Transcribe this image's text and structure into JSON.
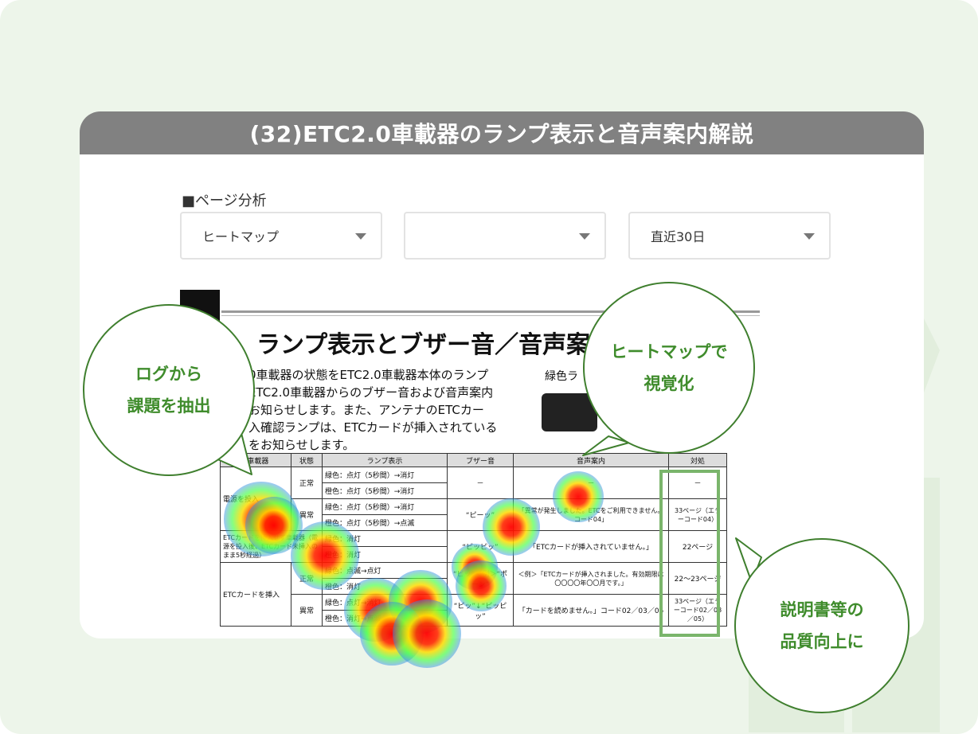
{
  "header": {
    "title": "(32)ETC2.0車載器のランプ表示と音声案内解説"
  },
  "section_label": "■ページ分析",
  "dropdowns": [
    {
      "value": "ヒートマップ"
    },
    {
      "value": ""
    },
    {
      "value": "直近30日"
    }
  ],
  "document": {
    "title": "ランプ表示とブザー音／音声案",
    "intro": "0車載器の状態をETC2.0車載器本体のランプ\nETC2.0車載器からのブザー音および音声案内\nお知らせします。また、アンテナのETCカー\n入確認ランプは、ETCカードが挿入されている\nをお知らせします。",
    "lamp_label": "緑色ラ",
    "table_headers": [
      "0車載器",
      "状態",
      "ランプ表示",
      "ブザー音",
      "音声案内",
      "対処"
    ],
    "rows": [
      {
        "c1": "電源を投入",
        "c2": "正常",
        "c3a": "緑色：点灯（5秒間）→消灯",
        "c3b": "橙色：点灯（5秒間）→消灯",
        "c4": "－",
        "c5": "－",
        "c6": "－"
      },
      {
        "c2": "異常",
        "c3a": "緑色：点灯（5秒間）→消灯",
        "c3b": "橙色：点灯（5秒間）→点滅",
        "c4": "“ピーッ”",
        "c5": "「異常が発生しました。ETCをご利用できません。コード04」",
        "c6": "33ページ（エラーコード04）"
      },
      {
        "c1": "ETCカードを挿入せず車載器（電源を投入後、ETCカード未挿入のまま5秒経過）",
        "c3a": "緑色：消灯",
        "c3b": "橙色：消灯",
        "c4": "“ピッピッ”",
        "c5": "「ETCカードが挿入されていません。」",
        "c6": "22ページ"
      },
      {
        "c1": "ETCカードを挿入",
        "c2": "正常",
        "c3a": "緑色：点滅→点灯",
        "c3b": "橙色：消灯",
        "c4": "“ピッ”＜例＞“ポーン”",
        "c5": "＜例＞「ETCカードが挿入されました。有効期限は〇〇〇〇年〇〇月です。」",
        "c6": "22～23ページ"
      },
      {
        "c2": "異常",
        "c3a": "緑色：点灯→消灯",
        "c3b": "橙色：消灯→点滅",
        "c4": "“ピッ”↓“ピッピッ”",
        "c5": "「カードを読めません。」コード02／03／05",
        "c6": "33ページ（エラーコード02／03／05）"
      }
    ]
  },
  "bubbles": [
    {
      "line1": "ログから",
      "line2": "課題を抽出"
    },
    {
      "line1": "ヒートマップで",
      "line2": "視覚化"
    },
    {
      "line1": "説明書等の",
      "line2": "品質向上に"
    }
  ],
  "colors": {
    "accent_green": "#3f8c2c",
    "header_gray": "#818181",
    "background": "#edf5ea",
    "highlight_box": "#7ab56b"
  }
}
